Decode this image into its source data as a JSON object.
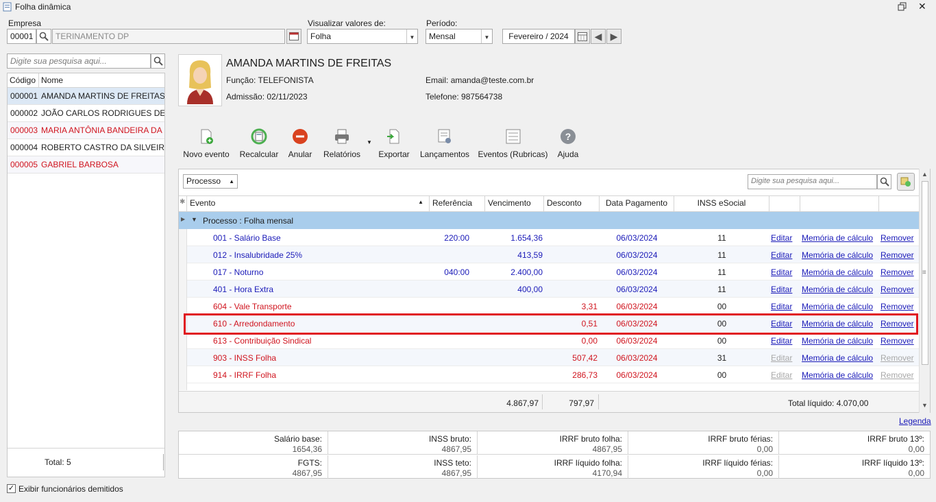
{
  "window": {
    "title": "Folha dinâmica"
  },
  "filters": {
    "empresa_label": "Empresa",
    "empresa_code": "00001",
    "empresa_name": "TERINAMENTO DP",
    "visualizar_label": "Visualizar valores de:",
    "visualizar_value": "Folha",
    "periodo_label": "Período:",
    "periodo_value": "Mensal",
    "period_date": "Fevereiro / 2024"
  },
  "left_panel": {
    "search_placeholder": "Digite sua pesquisa aqui...",
    "col_code": "Código",
    "col_name": "Nome",
    "employees": [
      {
        "code": "000001",
        "name": "AMANDA MARTINS DE FREITAS",
        "color": "#1e1e1e"
      },
      {
        "code": "000002",
        "name": "JOÃO CARLOS RODRIGUES DE",
        "color": "#1e1e1e"
      },
      {
        "code": "000003",
        "name": "MARIA ANTÔNIA BANDEIRA DA",
        "color": "#d0141e"
      },
      {
        "code": "000004",
        "name": "ROBERTO CASTRO DA SILVEIRA",
        "color": "#1e1e1e"
      },
      {
        "code": "000005",
        "name": "GABRIEL BARBOSA",
        "color": "#d0141e"
      }
    ],
    "total": "Total: 5",
    "show_dismissed": "Exibir funcionários demitidos"
  },
  "employee": {
    "name": "AMANDA MARTINS DE FREITAS",
    "funcao_label": "Função:",
    "funcao": "TELEFONISTA",
    "admissao_label": "Admissão:",
    "admissao": "02/11/2023",
    "email_label": "Email:",
    "email": "amanda@teste.com.br",
    "telefone_label": "Telefone:",
    "telefone": "987564738"
  },
  "toolbar": {
    "novo_evento": "Novo evento",
    "recalcular": "Recalcular",
    "anular": "Anular",
    "relatorios": "Relatórios",
    "exportar": "Exportar",
    "lancamentos": "Lançamentos",
    "eventos": "Eventos (Rubricas)",
    "ajuda": "Ajuda"
  },
  "grid": {
    "group_select": "Processo",
    "search_placeholder": "Digite sua pesquisa aqui...",
    "columns": {
      "evento": "Evento",
      "referencia": "Referência",
      "vencimento": "Vencimento",
      "desconto": "Desconto",
      "data_pagamento": "Data Pagamento",
      "inss_esocial": "INSS eSocial"
    },
    "group_row": "Processo : Folha mensal",
    "rows": [
      {
        "evento": "001 - Salário Base",
        "referencia": "220:00",
        "vencimento": "1.654,36",
        "desconto": "",
        "data": "06/03/2024",
        "inss": "11",
        "color": "#1a1ab8",
        "editar": "Editar",
        "memoria": "Memória de cálculo",
        "remover": "Remover",
        "links_enabled": true
      },
      {
        "evento": "012 - Insalubridade 25%",
        "referencia": "",
        "vencimento": "413,59",
        "desconto": "",
        "data": "06/03/2024",
        "inss": "11",
        "color": "#1a1ab8",
        "editar": "Editar",
        "memoria": "Memória de cálculo",
        "remover": "Remover",
        "links_enabled": true
      },
      {
        "evento": "017 - Noturno",
        "referencia": "040:00",
        "vencimento": "2.400,00",
        "desconto": "",
        "data": "06/03/2024",
        "inss": "11",
        "color": "#1a1ab8",
        "editar": "Editar",
        "memoria": "Memória de cálculo",
        "remover": "Remover",
        "links_enabled": true
      },
      {
        "evento": "401 - Hora Extra",
        "referencia": "",
        "vencimento": "400,00",
        "desconto": "",
        "data": "06/03/2024",
        "inss": "11",
        "color": "#1a1ab8",
        "editar": "Editar",
        "memoria": "Memória de cálculo",
        "remover": "Remover",
        "links_enabled": true
      },
      {
        "evento": "604 - Vale Transporte",
        "referencia": "",
        "vencimento": "",
        "desconto": "3,31",
        "data": "06/03/2024",
        "inss": "00",
        "color": "#d0141e",
        "editar": "Editar",
        "memoria": "Memória de cálculo",
        "remover": "Remover",
        "links_enabled": true
      },
      {
        "evento": "610 - Arredondamento",
        "referencia": "",
        "vencimento": "",
        "desconto": "0,51",
        "data": "06/03/2024",
        "inss": "00",
        "color": "#d0141e",
        "editar": "Editar",
        "memoria": "Memória de cálculo",
        "remover": "Remover",
        "links_enabled": true
      },
      {
        "evento": "613 - Contribuição Sindical",
        "referencia": "",
        "vencimento": "",
        "desconto": "0,00",
        "data": "06/03/2024",
        "inss": "00",
        "color": "#d0141e",
        "editar": "Editar",
        "memoria": "Memória de cálculo",
        "remover": "Remover",
        "links_enabled": true
      },
      {
        "evento": "903 - INSS Folha",
        "referencia": "",
        "vencimento": "",
        "desconto": "507,42",
        "data": "06/03/2024",
        "inss": "31",
        "color": "#d0141e",
        "editar": "Editar",
        "memoria": "Memória de cálculo",
        "remover": "Remover",
        "links_enabled": false
      },
      {
        "evento": "914 - IRRF Folha",
        "referencia": "",
        "vencimento": "",
        "desconto": "286,73",
        "data": "06/03/2024",
        "inss": "00",
        "color": "#d0141e",
        "editar": "Editar",
        "memoria": "Memória de cálculo",
        "remover": "Remover",
        "links_enabled": false
      }
    ],
    "total_vencimento": "4.867,97",
    "total_desconto": "797,97",
    "total_liquido": "Total líquido: 4.070,00"
  },
  "legend_link": "Legenda",
  "summary": {
    "row1": [
      {
        "label": "Salário base:",
        "value": "1654,36"
      },
      {
        "label": "INSS bruto:",
        "value": "4867,95"
      },
      {
        "label": "IRRF bruto folha:",
        "value": "4867,95"
      },
      {
        "label": "IRRF bruto férias:",
        "value": "0,00"
      },
      {
        "label": "IRRF bruto 13º:",
        "value": "0,00"
      }
    ],
    "row2": [
      {
        "label": "FGTS:",
        "value": "4867,95"
      },
      {
        "label": "INSS teto:",
        "value": "4867,95"
      },
      {
        "label": "IRRF líquido folha:",
        "value": "4170,94"
      },
      {
        "label": "IRRF líquido férias:",
        "value": "0,00"
      },
      {
        "label": "IRRF líquido 13º:",
        "value": "0,00"
      }
    ]
  },
  "colors": {
    "highlight_box": "#e0141e",
    "group_row": "#a9cdec",
    "selected_row": "#dce8f5"
  }
}
